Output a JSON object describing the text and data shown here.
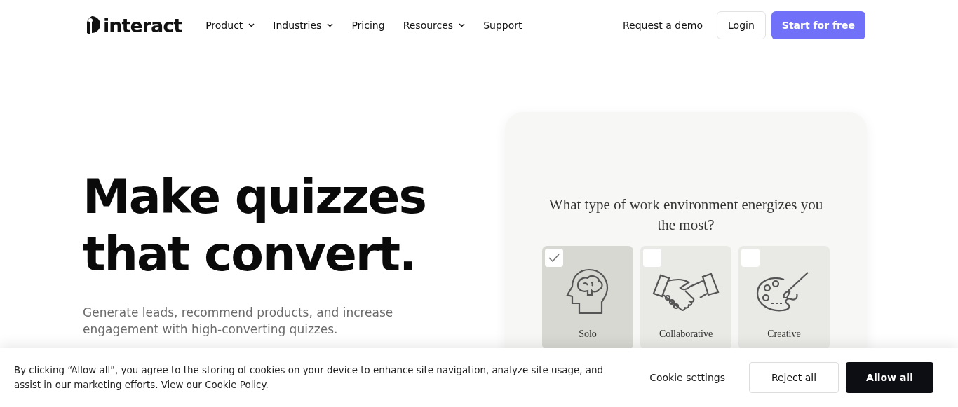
{
  "header": {
    "logo": "interact",
    "nav": [
      {
        "label": "Product",
        "has_menu": true
      },
      {
        "label": "Industries",
        "has_menu": true
      },
      {
        "label": "Pricing",
        "has_menu": false
      },
      {
        "label": "Resources",
        "has_menu": true
      },
      {
        "label": "Support",
        "has_menu": false
      }
    ],
    "demo_link": "Request a demo",
    "login_button": "Login",
    "start_button": "Start for free"
  },
  "hero": {
    "headline": [
      "Make quizzes",
      "that convert."
    ],
    "subtitle": "Generate leads, recommend products, and increase engagement with high-converting quizzes.",
    "quiz": {
      "question": "What type of work environment energizes you the most?",
      "options": [
        {
          "label": "Solo",
          "kind": "brain",
          "selected": true
        },
        {
          "label": "Collaborative",
          "kind": "handshake",
          "selected": false
        },
        {
          "label": "Creative",
          "kind": "palette",
          "selected": false
        }
      ]
    }
  },
  "cookie_banner": {
    "text": "By clicking “Allow all”, you agree to the storing of cookies on your device to enhance site navigation, analyze site usage, and assist in our marketing efforts.",
    "link": "View our Cookie Policy",
    "link_suffix": ".",
    "settings": "Cookie settings",
    "reject": "Reject all",
    "allow": "Allow all"
  }
}
